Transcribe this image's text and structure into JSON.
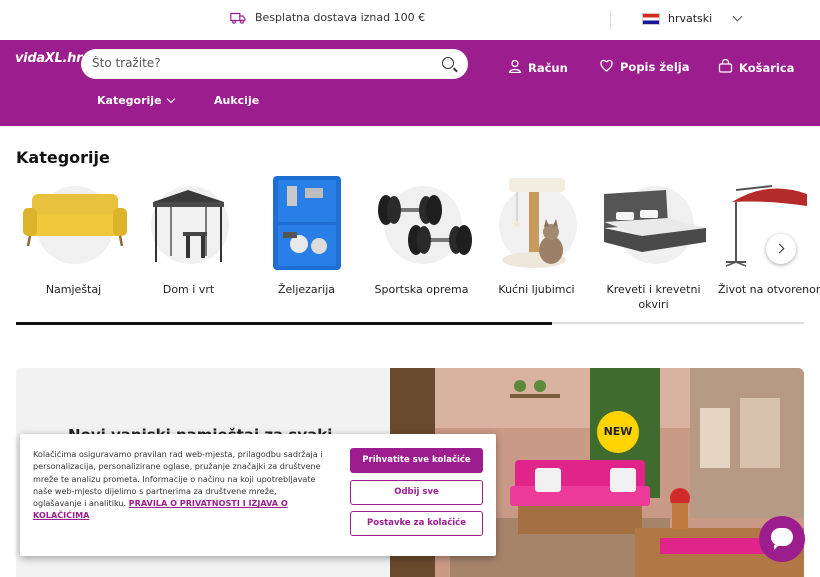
{
  "topbar": {
    "shipping_text": "Besplatna dostava iznad 100 €",
    "language": "hrvatski"
  },
  "header": {
    "logo_text": "vidaXL.hr",
    "search_placeholder": "Što tražite?",
    "account_label": "Račun",
    "wishlist_label": "Popis želja",
    "cart_label": "Košarica"
  },
  "nav": {
    "categories_label": "Kategorije",
    "auctions_label": "Aukcije"
  },
  "categories": {
    "title": "Kategorije",
    "items": [
      {
        "label": "Namještaj"
      },
      {
        "label": "Dom i vrt"
      },
      {
        "label": "Željezarija"
      },
      {
        "label": "Sportska oprema"
      },
      {
        "label": "Kućni ljubimci"
      },
      {
        "label": "Kreveti i krevetni okviri"
      },
      {
        "label": "Život na otvorenom"
      }
    ],
    "scroll_progress": 0.68
  },
  "banner": {
    "title": "Novi vanjski namještaj za svaki",
    "badge": "NEW"
  },
  "cookie": {
    "text": "Kolačićima osiguravamo pravilan rad web-mjesta, prilagodbu sadržaja i personalizacija, personalizirane oglase, pružanje značajki za društvene mreže te analizu prometa. Informacije o načinu na koji upotrebljavate naše web-mjesto dijelimo s partnerima za društvene mreže, oglašavanje i analitiku.",
    "policy_link": "PRAVILA O PRIVATNOSTI I IZJAVA O KOLAČIĆIMA",
    "accept_all": "Prihvatite sve kolačiće",
    "reject_all": "Odbij sve",
    "settings": "Postavke za kolačiće"
  },
  "colors": {
    "brand": "#9c1e8e",
    "badge": "#ffd400"
  }
}
